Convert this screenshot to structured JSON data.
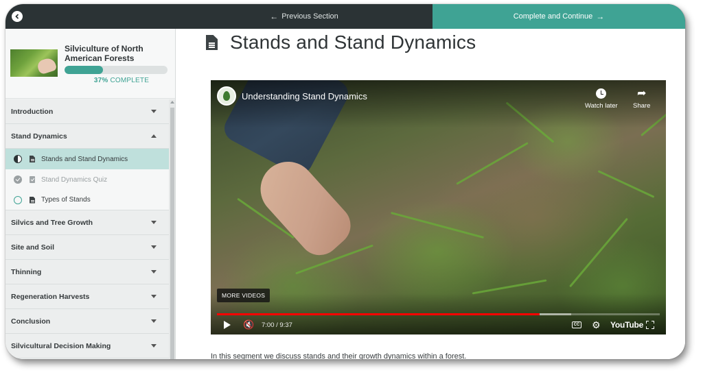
{
  "topbar": {
    "previous_label": "Previous Section",
    "next_label": "Complete and Continue",
    "accent_color": "#3fa394",
    "bar_color": "#2b3335"
  },
  "course": {
    "title": "Silviculture of North American Forests",
    "progress_percent": 37,
    "progress_text": "37%",
    "progress_suffix": "COMPLETE"
  },
  "modules": [
    {
      "label": "Introduction",
      "expanded": false
    },
    {
      "label": "Stand Dynamics",
      "expanded": true,
      "lessons": [
        {
          "label": "Stands and Stand Dynamics",
          "status": "in-progress",
          "type": "document",
          "active": true
        },
        {
          "label": "Stand Dynamics Quiz",
          "status": "completed",
          "type": "quiz",
          "active": false
        },
        {
          "label": "Types of Stands",
          "status": "not-started",
          "type": "document",
          "active": false
        }
      ]
    },
    {
      "label": "Silvics and Tree Growth",
      "expanded": false
    },
    {
      "label": "Site and Soil",
      "expanded": false
    },
    {
      "label": "Thinning",
      "expanded": false
    },
    {
      "label": "Regeneration Harvests",
      "expanded": false
    },
    {
      "label": "Conclusion",
      "expanded": false
    },
    {
      "label": "Silvicultural Decision Making",
      "expanded": false
    }
  ],
  "lesson": {
    "title": "Stands and Stand Dynamics",
    "description": "In this segment we discuss stands and their growth dynamics within a forest."
  },
  "video": {
    "title": "Understanding Stand Dynamics",
    "watch_later_label": "Watch later",
    "share_label": "Share",
    "more_videos_label": "MORE VIDEOS",
    "time_text": "7:00 / 9:37",
    "played_fraction": 0.728,
    "loaded_fraction": 0.8,
    "cc_label": "CC",
    "brand_label": "YouTube"
  }
}
